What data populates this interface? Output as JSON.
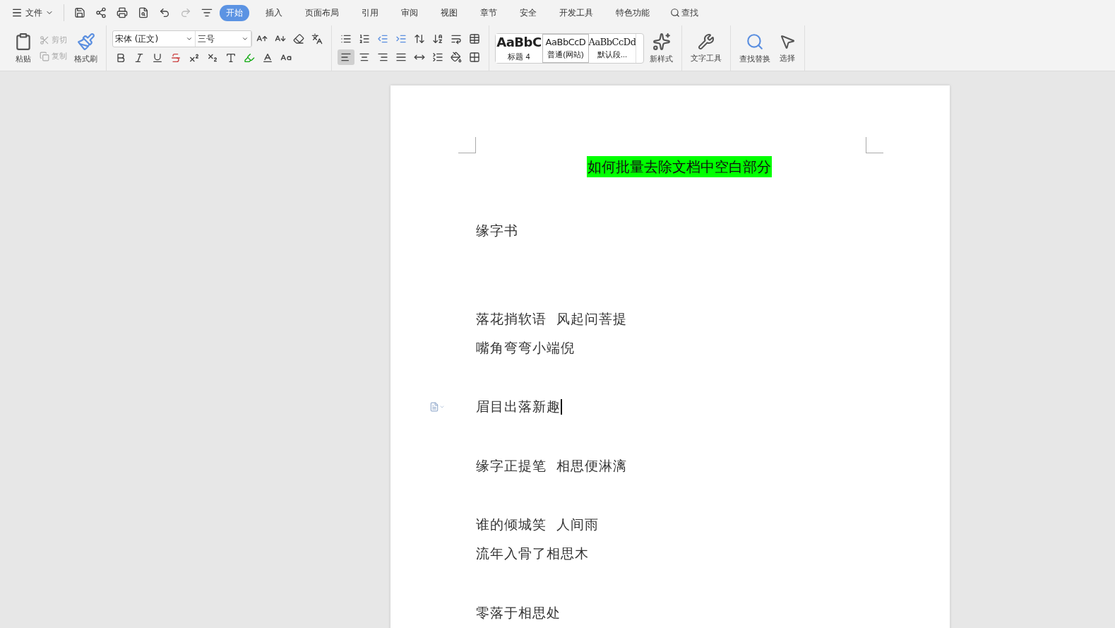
{
  "menu": {
    "file_label": "文件"
  },
  "tabs": [
    {
      "label": "开始",
      "selected": true
    },
    {
      "label": "插入",
      "selected": false
    },
    {
      "label": "页面布局",
      "selected": false
    },
    {
      "label": "引用",
      "selected": false
    },
    {
      "label": "审阅",
      "selected": false
    },
    {
      "label": "视图",
      "selected": false
    },
    {
      "label": "章节",
      "selected": false
    },
    {
      "label": "安全",
      "selected": false
    },
    {
      "label": "开发工具",
      "selected": false
    },
    {
      "label": "特色功能",
      "selected": false
    }
  ],
  "search": {
    "label": "查找"
  },
  "clipboard": {
    "paste": "粘贴",
    "cut": {
      "label": "剪切",
      "disabled": true
    },
    "copy": {
      "label": "复制",
      "disabled": true
    },
    "format_painter": "格式刷"
  },
  "font": {
    "name": "宋体 (正文)",
    "size": "三号"
  },
  "alignment": [
    {
      "selected": true
    },
    {
      "selected": false
    },
    {
      "selected": false
    },
    {
      "selected": false
    }
  ],
  "styles": [
    {
      "sample": "AaBbC",
      "label": "标题 4",
      "kind": "heading",
      "selected": false
    },
    {
      "sample": "AaBbCcD",
      "label": "普通(网站)",
      "kind": "normal",
      "selected": true
    },
    {
      "sample": "AaBbCcDd",
      "label": "默认段...",
      "kind": "serif",
      "selected": false
    }
  ],
  "tools": [
    {
      "label": "新样式",
      "kind": "new-style"
    },
    {
      "label": "文字工具",
      "kind": "text-tools"
    },
    {
      "label": "查找替换",
      "kind": "find-replace"
    },
    {
      "label": "选择",
      "kind": "select"
    }
  ],
  "document": {
    "title": "如何批量去除文档中空白部分",
    "paragraphs": [
      {
        "kind": "text",
        "text": "缘字书",
        "cursor": false
      },
      {
        "kind": "blank"
      },
      {
        "kind": "blank"
      },
      {
        "kind": "text",
        "text": "落花捎软语  风起问菩提",
        "cursor": false
      },
      {
        "kind": "text",
        "text": "嘴角弯弯小端倪",
        "cursor": false
      },
      {
        "kind": "blank"
      },
      {
        "kind": "text",
        "text": "眉目出落新趣",
        "cursor": true
      },
      {
        "kind": "blank"
      },
      {
        "kind": "text",
        "text": "缘字正提笔  相思便淋漓",
        "cursor": false
      },
      {
        "kind": "blank"
      },
      {
        "kind": "text",
        "text": "谁的倾城笑  人间雨",
        "cursor": false
      },
      {
        "kind": "text",
        "text": "流年入骨了相思木",
        "cursor": false
      },
      {
        "kind": "blank"
      },
      {
        "kind": "text",
        "text": "零落于相思处",
        "cursor": false
      }
    ]
  }
}
